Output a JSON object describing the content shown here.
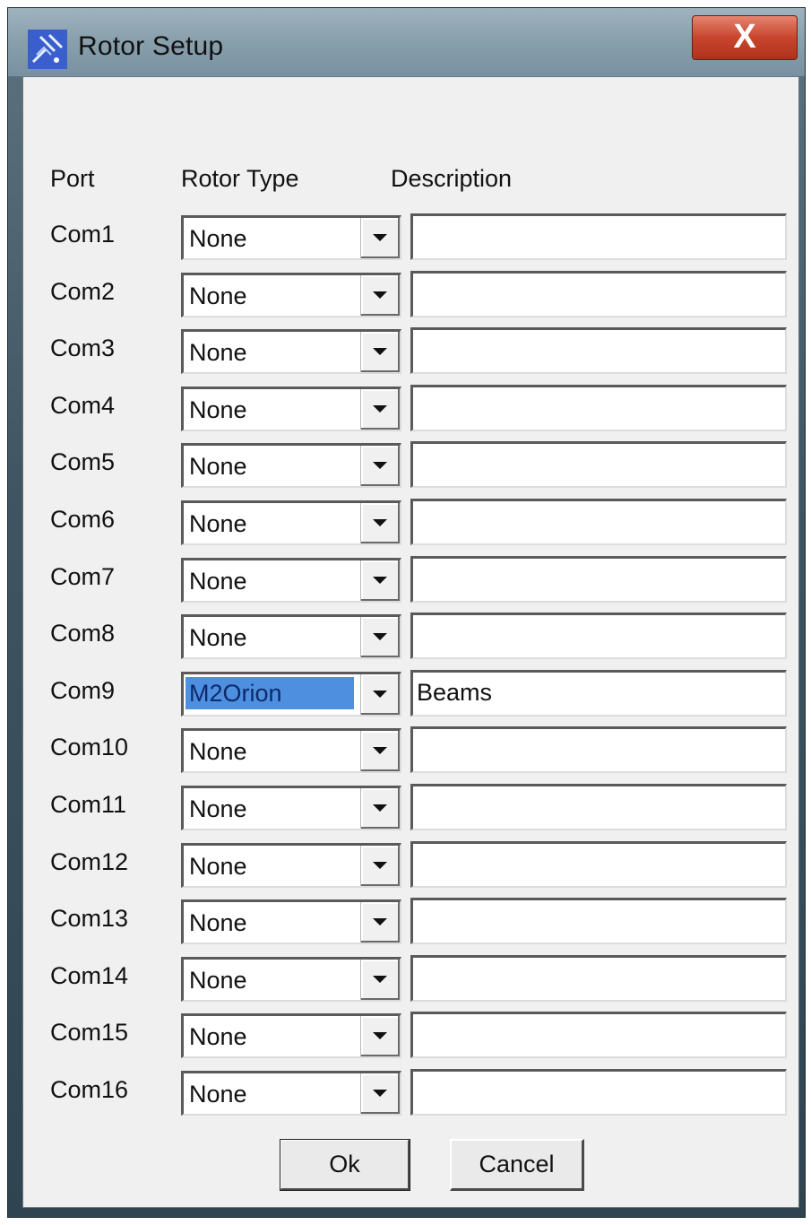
{
  "window": {
    "title": "Rotor Setup",
    "close_label": "X"
  },
  "headers": {
    "port": "Port",
    "rotor_type": "Rotor Type",
    "description": "Description"
  },
  "rows": [
    {
      "port": "Com1",
      "rotor_type": "None",
      "description": ""
    },
    {
      "port": "Com2",
      "rotor_type": "None",
      "description": ""
    },
    {
      "port": "Com3",
      "rotor_type": "None",
      "description": ""
    },
    {
      "port": "Com4",
      "rotor_type": "None",
      "description": ""
    },
    {
      "port": "Com5",
      "rotor_type": "None",
      "description": ""
    },
    {
      "port": "Com6",
      "rotor_type": "None",
      "description": ""
    },
    {
      "port": "Com7",
      "rotor_type": "None",
      "description": ""
    },
    {
      "port": "Com8",
      "rotor_type": "None",
      "description": ""
    },
    {
      "port": "Com9",
      "rotor_type": "M2Orion",
      "description": "Beams",
      "selected": true
    },
    {
      "port": "Com10",
      "rotor_type": "None",
      "description": ""
    },
    {
      "port": "Com11",
      "rotor_type": "None",
      "description": ""
    },
    {
      "port": "Com12",
      "rotor_type": "None",
      "description": ""
    },
    {
      "port": "Com13",
      "rotor_type": "None",
      "description": ""
    },
    {
      "port": "Com14",
      "rotor_type": "None",
      "description": ""
    },
    {
      "port": "Com15",
      "rotor_type": "None",
      "description": ""
    },
    {
      "port": "Com16",
      "rotor_type": "None",
      "description": ""
    }
  ],
  "buttons": {
    "ok": "Ok",
    "cancel": "Cancel"
  },
  "colors": {
    "selection": "#4f8fe0",
    "close_button": "#c8452d",
    "dialog_bg": "#f0f0f0"
  },
  "icons": {
    "app": "satellite-icon",
    "dropdown": "chevron-down-icon"
  }
}
